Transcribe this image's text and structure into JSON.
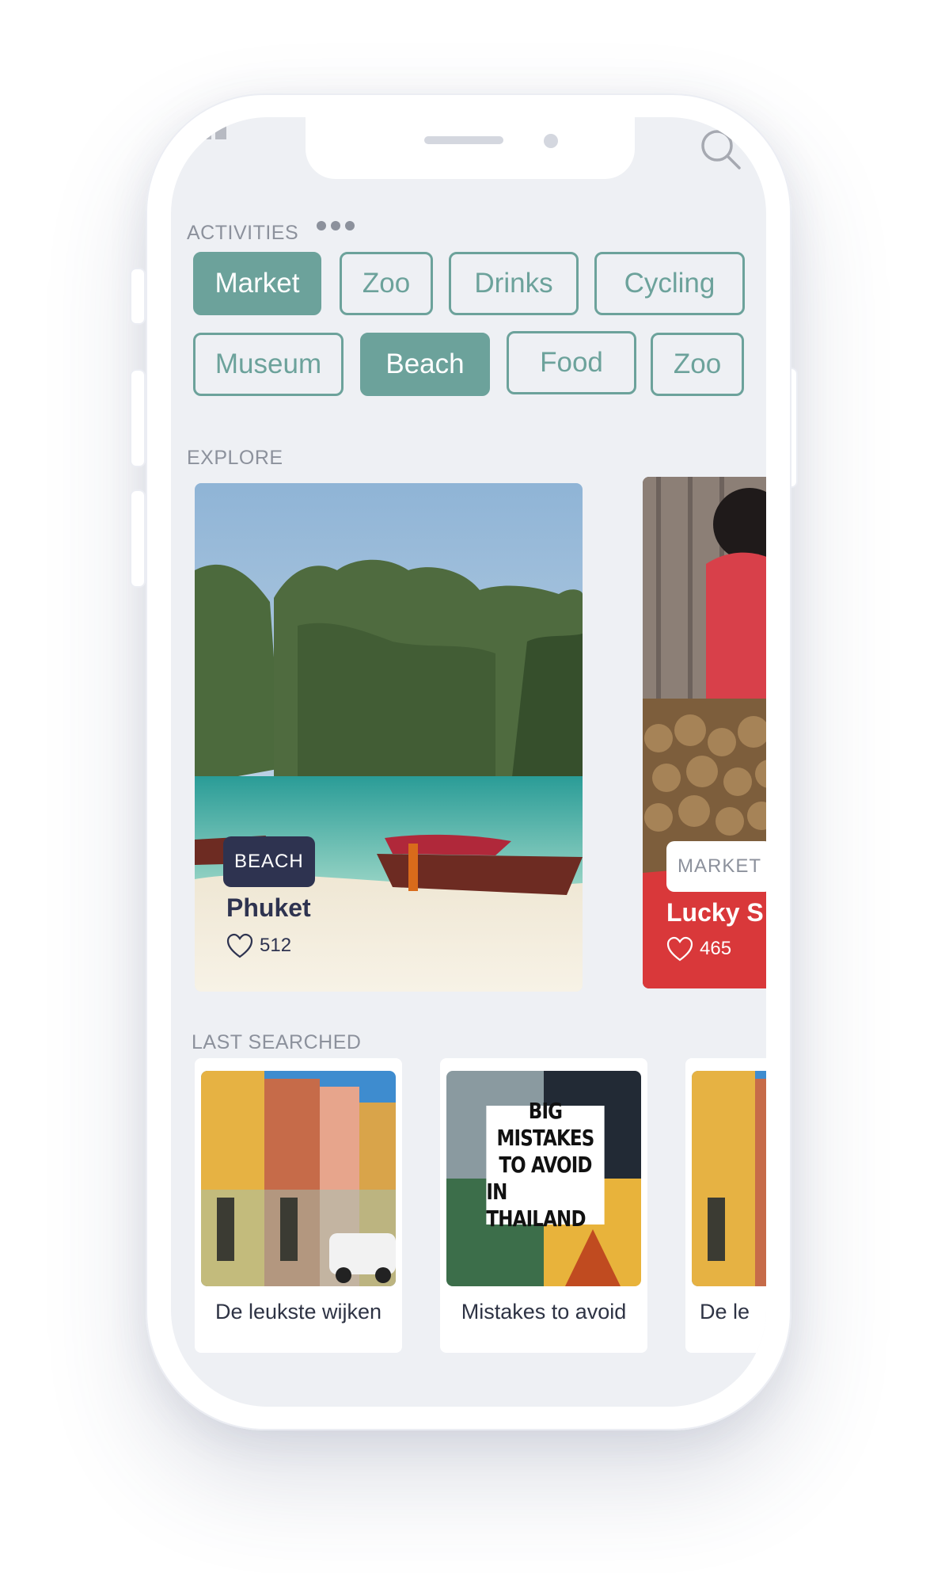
{
  "activities": {
    "title": "ACTIVITIES",
    "chips": [
      {
        "label": "Market",
        "active": true
      },
      {
        "label": "Zoo",
        "active": false
      },
      {
        "label": "Drinks",
        "active": false
      },
      {
        "label": "Cycling",
        "active": false
      },
      {
        "label": "Museum",
        "active": false
      },
      {
        "label": "Beach",
        "active": true
      },
      {
        "label": "Food",
        "active": false
      },
      {
        "label": "Zoo",
        "active": false
      }
    ]
  },
  "explore": {
    "title": "EXPLORE",
    "cards": [
      {
        "category": "BEACH",
        "title": "Phuket",
        "likes": "512"
      },
      {
        "category": "MARKET",
        "title": "Lucky S",
        "likes": "465"
      }
    ]
  },
  "last_searched": {
    "title": "LAST SEARCHED",
    "items": [
      {
        "label": "De leukste wijken"
      },
      {
        "label": "Mistakes to avoid",
        "image_text": [
          "BIG",
          "MISTAKES",
          "TO AVOID",
          "IN THAILAND"
        ]
      },
      {
        "label": "De le"
      }
    ]
  },
  "colors": {
    "accent": "#6ca29b",
    "screen_bg": "#eef0f4",
    "badge_dark": "#2e3350",
    "label_gray": "#8c919c"
  },
  "icons": [
    "signal-icon",
    "search-icon",
    "more-dots-icon",
    "heart-icon"
  ]
}
